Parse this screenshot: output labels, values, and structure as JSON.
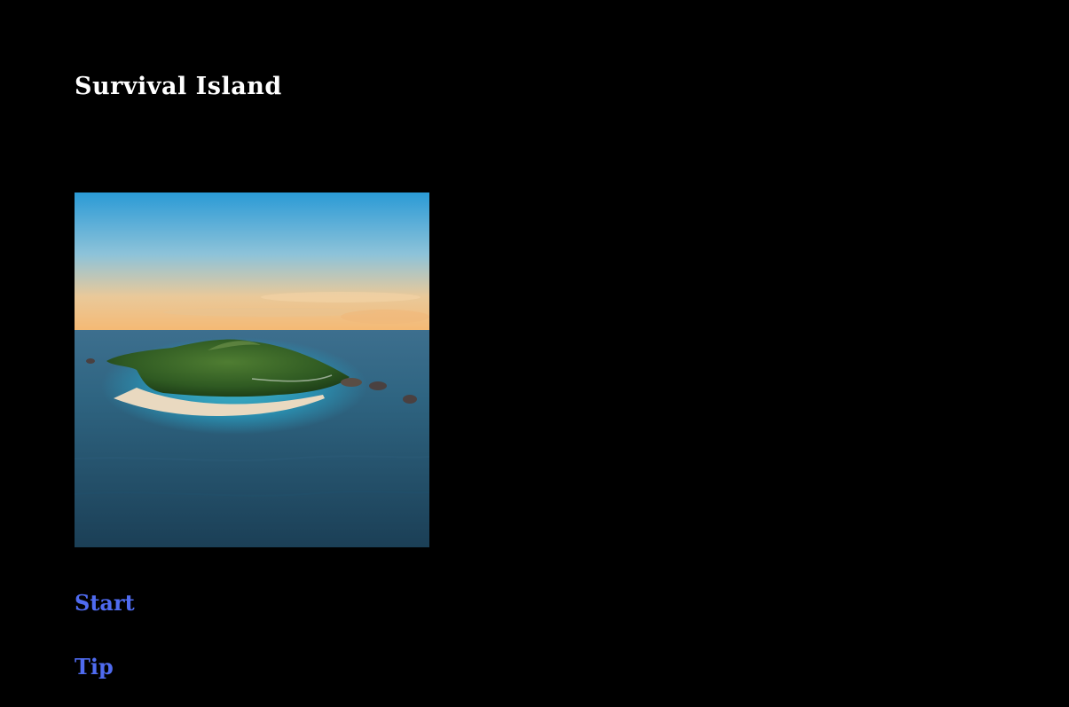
{
  "game": {
    "title": "Survival Island"
  },
  "menu": {
    "start_label": "Start",
    "tip_label": "Tip"
  },
  "colors": {
    "background": "#000000",
    "title": "#ffffff",
    "link": "#4f6bf0"
  },
  "image": {
    "icon": "island-photo"
  }
}
